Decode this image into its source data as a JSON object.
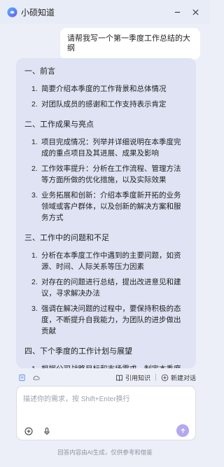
{
  "window": {
    "title": "小硕知道"
  },
  "user_message": "请帮我写一个第一季度工作总结的大纲",
  "answer": {
    "sections": [
      {
        "heading": "一、前言",
        "items": [
          {
            "num": "1.",
            "text": "简要介绍本季度的工作背景和总体情况"
          },
          {
            "num": "2.",
            "text": "对团队成员的感谢和工作支持表示肯定"
          }
        ]
      },
      {
        "heading": "二、工作成果与亮点",
        "items": [
          {
            "num": "1.",
            "text": "项目完成情况：列举并详细说明在本季度完成的重点项目及其进展、成果及影响"
          },
          {
            "num": "2.",
            "text": "工作效率提升：分析在工作流程、管理方法等方面所做的优化措施，以及实际效果"
          },
          {
            "num": "3.",
            "text": "业务拓展和创新：介绍本季度新开拓的业务领域或客户群体，以及创新的解决方案和服务方式"
          }
        ]
      },
      {
        "heading": "三、工作中的问题和不足",
        "items": [
          {
            "num": "1.",
            "text": "分析在本季度工作中遇到的主要问题，如资源、时间、人际关系等压力因素"
          },
          {
            "num": "2.",
            "text": "对存在的问题进行总结，提出改进意见和建议，寻求解决办法"
          },
          {
            "num": "3.",
            "text": "强调在解决问题的过程中，要保持积极的态度，不断提升自我能力，为团队的进步做出贡献"
          }
        ]
      },
      {
        "heading": "四、下个季度的工作计划与展望",
        "items": [
          {
            "num": "1.",
            "text": "根据公司战略目标和市场需求，制定本季度的工作重点和发展方向"
          }
        ]
      }
    ]
  },
  "actions": {
    "cite_knowledge": "引用知识",
    "new_chat": "新建对话"
  },
  "input": {
    "placeholder": "描述你的需求，按 Shift+Enter换行",
    "value": ""
  },
  "disclaimer": "回答内容由AI生成，仅供参考和借鉴",
  "colors": {
    "accent": "#b3a8f1",
    "answer_bg": "#dfe3f4",
    "window_bg": "#eceff8"
  }
}
